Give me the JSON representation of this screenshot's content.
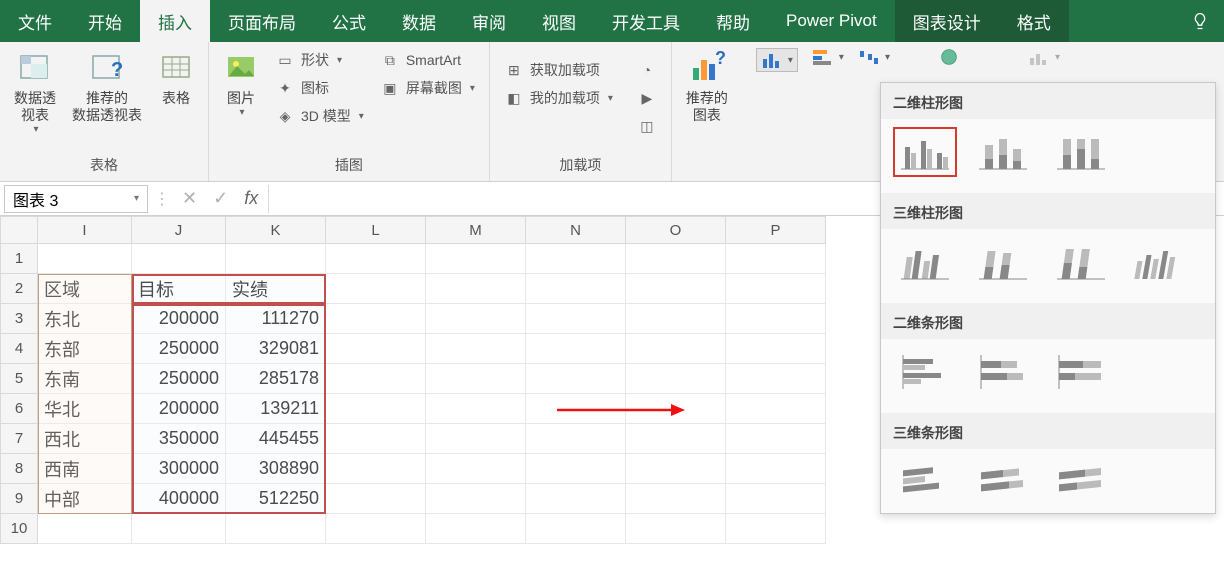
{
  "tabs": [
    "文件",
    "开始",
    "插入",
    "页面布局",
    "公式",
    "数据",
    "审阅",
    "视图",
    "开发工具",
    "帮助",
    "Power Pivot",
    "图表设计",
    "格式"
  ],
  "activeTab": 2,
  "contextualTabs": [
    11,
    12
  ],
  "ribbon": {
    "group_tables": {
      "label": "表格",
      "pivot": "数据透\n视表",
      "rec_pivot": "推荐的\n数据透视表",
      "table": "表格"
    },
    "group_illust": {
      "label": "插图",
      "pic": "图片",
      "shapes": "形状",
      "icons": "图标",
      "model3d": "3D 模型",
      "smartart": "SmartArt",
      "screenshot": "屏幕截图"
    },
    "group_addins": {
      "label": "加载项",
      "get": "获取加载项",
      "my": "我的加载项"
    },
    "group_charts": {
      "rec_chart": "推荐的\n图表"
    }
  },
  "namebox": "图表 3",
  "columns": [
    "I",
    "J",
    "K",
    "L",
    "M",
    "N",
    "O",
    "P"
  ],
  "rows": [
    "1",
    "2",
    "3",
    "4",
    "5",
    "6",
    "7",
    "8",
    "9",
    "10"
  ],
  "table": {
    "headers": [
      "区域",
      "目标",
      "实绩"
    ],
    "data": [
      [
        "东北",
        "200000",
        "111270"
      ],
      [
        "东部",
        "250000",
        "329081"
      ],
      [
        "东南",
        "250000",
        "285178"
      ],
      [
        "华北",
        "200000",
        "139211"
      ],
      [
        "西北",
        "350000",
        "445455"
      ],
      [
        "西南",
        "300000",
        "308890"
      ],
      [
        "中部",
        "400000",
        "512250"
      ]
    ]
  },
  "chartPanel": {
    "s1": "二维柱形图",
    "s2": "三维柱形图",
    "s3": "二维条形图",
    "s4": "三维条形图"
  },
  "chart_data": {
    "type": "bar",
    "categories": [
      "东北",
      "东部",
      "东南",
      "华北",
      "西北",
      "西南",
      "中部"
    ],
    "series": [
      {
        "name": "目标",
        "values": [
          200000,
          250000,
          250000,
          200000,
          350000,
          300000,
          400000
        ]
      },
      {
        "name": "实绩",
        "values": [
          111270,
          329081,
          285178,
          139211,
          445455,
          308890,
          512250
        ]
      }
    ],
    "title": "",
    "xlabel": "区域",
    "ylabel": ""
  }
}
